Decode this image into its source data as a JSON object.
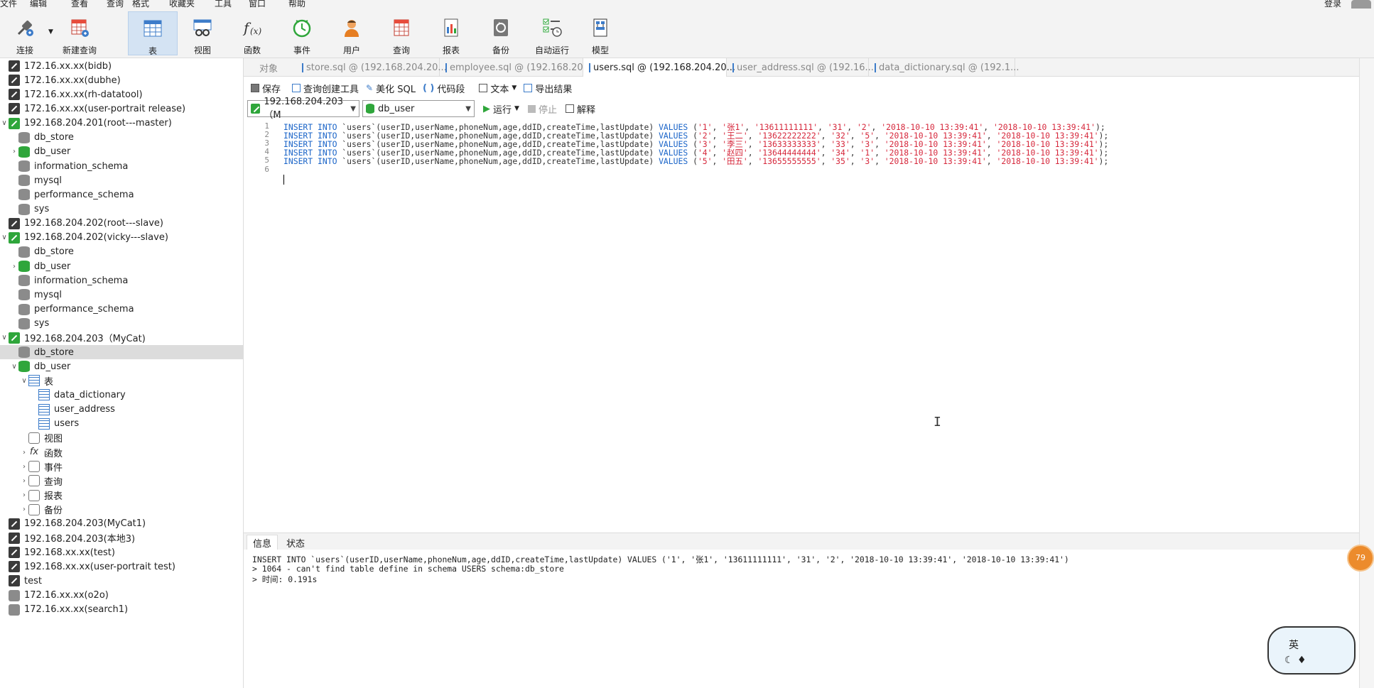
{
  "menubar": {
    "items": [
      "文件",
      "编辑",
      "查看",
      "查询",
      "格式",
      "收藏夹",
      "工具",
      "窗口",
      "帮助"
    ],
    "login": "登录"
  },
  "toolbar": {
    "buttons": [
      {
        "label": "连接",
        "icon": "plug-icon"
      },
      {
        "label": "新建查询",
        "icon": "new-query-icon"
      },
      {
        "label": "表",
        "icon": "table-icon"
      },
      {
        "label": "视图",
        "icon": "view-icon"
      },
      {
        "label": "函数",
        "icon": "function-icon"
      },
      {
        "label": "事件",
        "icon": "clock-icon"
      },
      {
        "label": "用户",
        "icon": "user-icon"
      },
      {
        "label": "查询",
        "icon": "query-icon"
      },
      {
        "label": "报表",
        "icon": "report-icon"
      },
      {
        "label": "备份",
        "icon": "backup-icon"
      },
      {
        "label": "自动运行",
        "icon": "schedule-icon"
      },
      {
        "label": "模型",
        "icon": "model-icon"
      }
    ]
  },
  "sidebar": {
    "items": [
      {
        "label": "172.16.xx.xx(bidb)",
        "icon": "connection-icon",
        "depth": 0
      },
      {
        "label": "172.16.xx.xx(dubhe)",
        "icon": "connection-icon",
        "depth": 0
      },
      {
        "label": "172.16.xx.xx(rh-datatool)",
        "icon": "connection-icon",
        "depth": 0
      },
      {
        "label": "172.16.xx.xx(user-portrait release)",
        "icon": "connection-icon",
        "depth": 0
      },
      {
        "label": "192.168.204.201(root---master)",
        "icon": "connection-icon-open",
        "depth": 0,
        "expanded": true
      },
      {
        "label": "db_store",
        "icon": "database-icon",
        "depth": 1
      },
      {
        "label": "db_user",
        "icon": "database-icon-open",
        "depth": 1,
        "collapsed": true
      },
      {
        "label": "information_schema",
        "icon": "database-icon",
        "depth": 1
      },
      {
        "label": "mysql",
        "icon": "database-icon",
        "depth": 1
      },
      {
        "label": "performance_schema",
        "icon": "database-icon",
        "depth": 1
      },
      {
        "label": "sys",
        "icon": "database-icon",
        "depth": 1
      },
      {
        "label": "192.168.204.202(root---slave)",
        "icon": "connection-icon",
        "depth": 0
      },
      {
        "label": "192.168.204.202(vicky---slave)",
        "icon": "connection-icon-open",
        "depth": 0,
        "expanded": true
      },
      {
        "label": "db_store",
        "icon": "database-icon",
        "depth": 1
      },
      {
        "label": "db_user",
        "icon": "database-icon-open",
        "depth": 1,
        "collapsed": true
      },
      {
        "label": "information_schema",
        "icon": "database-icon",
        "depth": 1
      },
      {
        "label": "mysql",
        "icon": "database-icon",
        "depth": 1
      },
      {
        "label": "performance_schema",
        "icon": "database-icon",
        "depth": 1
      },
      {
        "label": "sys",
        "icon": "database-icon",
        "depth": 1
      },
      {
        "label": "192.168.204.203（MyCat)",
        "icon": "connection-icon-open",
        "depth": 0,
        "expanded": true
      },
      {
        "label": "db_store",
        "icon": "database-icon",
        "depth": 1,
        "selected": true
      },
      {
        "label": "db_user",
        "icon": "database-icon-open",
        "depth": 1,
        "expanded": true
      },
      {
        "label": "表",
        "icon": "table-group-icon",
        "depth": 2,
        "expanded": true
      },
      {
        "label": "data_dictionary",
        "icon": "table-icon",
        "depth": 3
      },
      {
        "label": "user_address",
        "icon": "table-icon",
        "depth": 3
      },
      {
        "label": "users",
        "icon": "table-icon",
        "depth": 3
      },
      {
        "label": "视图",
        "icon": "view-icon",
        "depth": 2
      },
      {
        "label": "函数",
        "icon": "function-icon",
        "depth": 2,
        "collapsed": true
      },
      {
        "label": "事件",
        "icon": "clock-icon",
        "depth": 2,
        "collapsed": true
      },
      {
        "label": "查询",
        "icon": "query-icon",
        "depth": 2,
        "collapsed": true
      },
      {
        "label": "报表",
        "icon": "report-icon",
        "depth": 2,
        "collapsed": true
      },
      {
        "label": "备份",
        "icon": "backup-icon",
        "depth": 2,
        "collapsed": true
      },
      {
        "label": "192.168.204.203(MyCat1)",
        "icon": "connection-icon",
        "depth": 0
      },
      {
        "label": "192.168.204.203(本地3)",
        "icon": "connection-icon",
        "depth": 0
      },
      {
        "label": "192.168.xx.xx(test)",
        "icon": "connection-icon",
        "depth": 0
      },
      {
        "label": "192.168.xx.xx(user-portrait test)",
        "icon": "connection-icon",
        "depth": 0
      },
      {
        "label": "test",
        "icon": "connection-icon",
        "depth": 0
      },
      {
        "label": "172.16.xx.xx(o2o)",
        "icon": "connection-gray-icon",
        "depth": 0
      },
      {
        "label": "172.16.xx.xx(search1)",
        "icon": "connection-gray-icon",
        "depth": 0
      }
    ]
  },
  "tabs": [
    {
      "label": "对象",
      "active": false
    },
    {
      "label": "store.sql @ (192.168.204.20...",
      "active": false
    },
    {
      "label": "employee.sql @ (192.168.20...",
      "active": false
    },
    {
      "label": "users.sql @ (192.168.204.20...",
      "active": true
    },
    {
      "label": "user_address.sql @ (192.16...",
      "active": false
    },
    {
      "label": "data_dictionary.sql @ (192.1...",
      "active": false
    }
  ],
  "query_toolbar": {
    "save": "保存",
    "builder": "查询创建工具",
    "beautify": "美化 SQL",
    "snippet": "代码段",
    "text": "文本",
    "export": "导出结果"
  },
  "selectors": {
    "connection": "192.168.204.203（M",
    "database": "db_user",
    "run": "运行",
    "stop": "停止",
    "explain": "解释"
  },
  "editor": {
    "lines": [
      {
        "n": "1",
        "pre": "INSERT INTO ",
        "tbl": "`users`(userID,userName,phoneNum,age,ddID,createTime,lastUpdate) ",
        "values_kw": "VALUES",
        "vals": [
          "'1'",
          "'张1'",
          "'13611111111'",
          "'31'",
          "'2'",
          "'2018-10-10 13:39:41'",
          "'2018-10-10 13:39:41'"
        ]
      },
      {
        "n": "2",
        "pre": "INSERT INTO ",
        "tbl": "`users`(userID,userName,phoneNum,age,ddID,createTime,lastUpdate) ",
        "values_kw": "VALUES",
        "vals": [
          "'2'",
          "'王二'",
          "'13622222222'",
          "'32'",
          "'5'",
          "'2018-10-10 13:39:41'",
          "'2018-10-10 13:39:41'"
        ]
      },
      {
        "n": "3",
        "pre": "INSERT INTO ",
        "tbl": "`users`(userID,userName,phoneNum,age,ddID,createTime,lastUpdate) ",
        "values_kw": "VALUES",
        "vals": [
          "'3'",
          "'李三'",
          "'13633333333'",
          "'33'",
          "'3'",
          "'2018-10-10 13:39:41'",
          "'2018-10-10 13:39:41'"
        ]
      },
      {
        "n": "4",
        "pre": "INSERT INTO ",
        "tbl": "`users`(userID,userName,phoneNum,age,ddID,createTime,lastUpdate) ",
        "values_kw": "VALUES",
        "vals": [
          "'4'",
          "'赵四'",
          "'13644444444'",
          "'34'",
          "'1'",
          "'2018-10-10 13:39:41'",
          "'2018-10-10 13:39:41'"
        ]
      },
      {
        "n": "5",
        "pre": "INSERT INTO ",
        "tbl": "`users`(userID,userName,phoneNum,age,ddID,createTime,lastUpdate) ",
        "values_kw": "VALUES",
        "vals": [
          "'5'",
          "'田五'",
          "'13655555555'",
          "'35'",
          "'3'",
          "'2018-10-10 13:39:41'",
          "'2018-10-10 13:39:41'"
        ]
      },
      {
        "n": "6",
        "pre": "",
        "tbl": "",
        "values_kw": "",
        "vals": []
      }
    ]
  },
  "bottom_tabs": [
    "信息",
    "状态"
  ],
  "output": {
    "lines": [
      "INSERT INTO `users`(userID,userName,phoneNum,age,ddID,createTime,lastUpdate) VALUES ('1', '张1', '13611111111', '31', '2', '2018-10-10 13:39:41', '2018-10-10 13:39:41')",
      "> 1064 - can't find table define in schema USERS schema:db_store",
      "> 时间: 0.191s"
    ]
  },
  "floating": {
    "badge": "79",
    "ime_label": "英"
  },
  "colors": {
    "keyword": "#1a64c8",
    "string": "#d6283c",
    "selection": "#d4e3f3"
  }
}
